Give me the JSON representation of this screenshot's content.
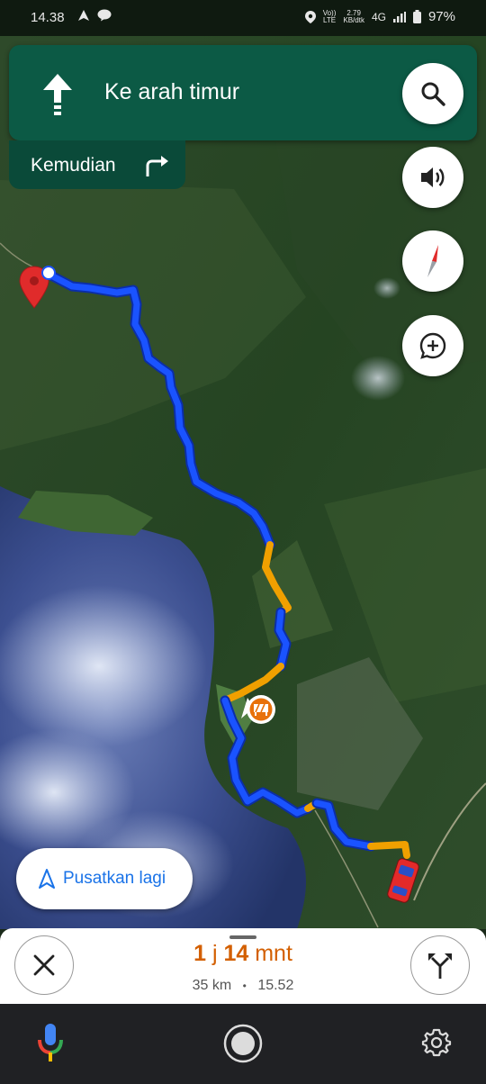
{
  "status_bar": {
    "time": "14.38",
    "network_top": "Vo))",
    "network_bottom": "LTE",
    "speed_top": "2.79",
    "speed_bottom": "KB/dtk",
    "signal": "4G",
    "battery": "97%"
  },
  "navigation": {
    "instruction": "Ke arah timur",
    "then_label": "Kemudian",
    "colors": {
      "header": "#0c5a45",
      "header_secondary": "#0a4a39"
    }
  },
  "map": {
    "route_colors": {
      "clear": "#1a53ff",
      "slow": "#f0a000"
    },
    "recenter_label": "Pusatkan lagi"
  },
  "bottom_sheet": {
    "eta_hours": "1",
    "eta_hours_unit": "j",
    "eta_minutes": "14",
    "eta_minutes_unit": "mnt",
    "distance": "35 km",
    "separator": "•",
    "arrival_time": "15.52",
    "eta_color": "#d35f00"
  },
  "icons": [
    "search-icon",
    "volume-icon",
    "compass-icon",
    "add-report-icon",
    "close-icon",
    "alternate-routes-icon",
    "mic-icon",
    "home-icon",
    "settings-icon"
  ]
}
